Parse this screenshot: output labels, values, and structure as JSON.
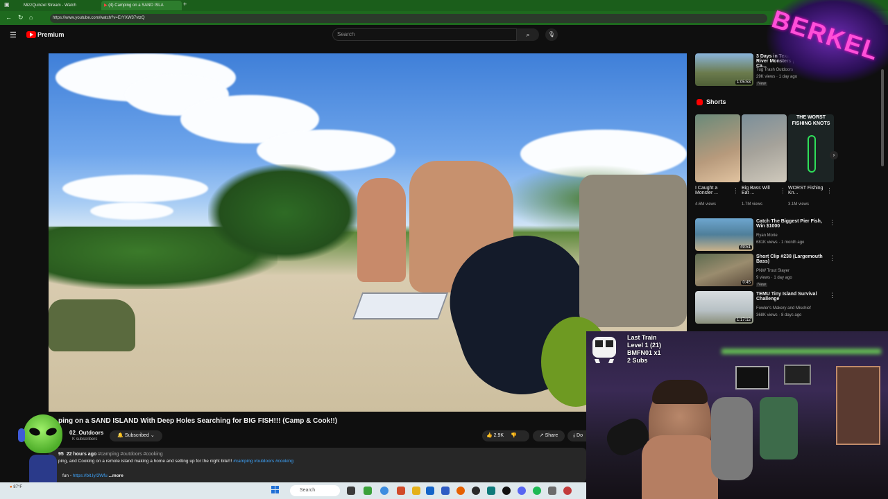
{
  "browser": {
    "tabs": [
      "MizzQuinzel Stream - Watch",
      "(4) Camping on a SAND ISLA"
    ],
    "url": "https://www.youtube.com/watch?v=ErYXW37vtzQ"
  },
  "youtube": {
    "logo_text": "Premium",
    "search_placeholder": "Search",
    "video": {
      "title": "ping on a SAND ISLAND With Deep Holes Searching for BIG FISH!!! (Camp & Cook!!)",
      "channel": "02_Outdoors",
      "subscribers": "K subscribers",
      "subscribe_label": "Subscribed",
      "likes": "2.9K",
      "share_label": "Share",
      "download_label": "Do",
      "posted": "22 hours ago",
      "hashtags": "#camping #outdoors #cooking",
      "desc_line": "ping, and Cooking on a remote island making a home and setting up for the night bite!!!",
      "desc_tags": "#camping #outdoors #cooking",
      "desc_link_prefix": "fun -",
      "desc_link": "https://bit.ly/3Wfu",
      "more_label": "...more",
      "views_prefix": "95"
    },
    "sidebar": {
      "top_video": {
        "title": "3 Days in Texas River Monsters | Ca...",
        "channel": "Tug Trash Outdoors",
        "meta": "29K views · 1 day ago",
        "badge": "New",
        "duration": "1:05:53"
      },
      "shorts_heading": "Shorts",
      "shorts": [
        {
          "title": "I Caught a Monster ...",
          "views": "4.6M views"
        },
        {
          "title": "Big Bass Will Eat ...",
          "views": "1.7M views"
        },
        {
          "title": "WORST Fishing Kn...",
          "views": "3.1M views",
          "thumb_text": "THE WORST FISHING KNOTS"
        }
      ],
      "videos": [
        {
          "title": "Catch The Biggest Pier Fish, Win $1000",
          "channel": "Ryan Morie",
          "meta": "681K views · 1 month ago",
          "duration": "49:51"
        },
        {
          "title": "Short Clip #238 (Largemouth Bass)",
          "channel": "PNW Trout Slayer",
          "meta": "9 views · 1 day ago",
          "badge": "New",
          "duration": "0:45"
        },
        {
          "title": "TEMU Tiny Island Survival Challenge",
          "channel": "Fowler's Makery and Mischief",
          "meta": "368K views · 8 days ago",
          "duration": "1:17:12"
        }
      ]
    }
  },
  "stream_overlay": {
    "title": "Last Train",
    "level": "Level 1  (21)",
    "user": "BMFN01 x1",
    "subs": "2 Subs",
    "logo_text": "BERKEL"
  },
  "taskbar": {
    "search_label": "Search",
    "weather": "87°F"
  },
  "colors": {
    "tab_green": "#1b5e1b",
    "yt_red": "#ff0000",
    "bg": "#0f0f0f"
  }
}
